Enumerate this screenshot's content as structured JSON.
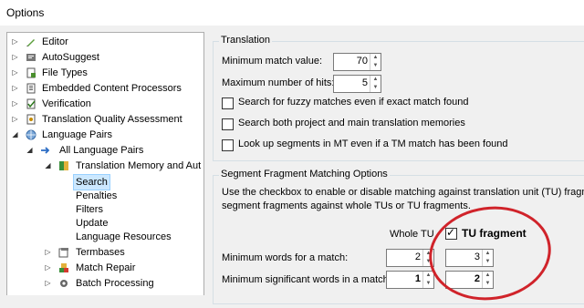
{
  "window": {
    "title": "Options"
  },
  "tree": [
    {
      "label": "Editor",
      "icon": "pencil-icon",
      "indent": 0
    },
    {
      "label": "AutoSuggest",
      "icon": "autosuggest-icon",
      "indent": 0
    },
    {
      "label": "File Types",
      "icon": "file-types-icon",
      "indent": 0
    },
    {
      "label": "Embedded Content Processors",
      "icon": "processor-icon",
      "indent": 0
    },
    {
      "label": "Verification",
      "icon": "verification-icon",
      "indent": 0
    },
    {
      "label": "Translation Quality Assessment",
      "icon": "quality-icon",
      "indent": 0
    },
    {
      "label": "Language Pairs",
      "icon": "globe-icon",
      "indent": 0
    },
    {
      "label": "All Language Pairs",
      "icon": "arrow-right-icon",
      "indent": 1
    },
    {
      "label": "Translation Memory and Aut",
      "icon": "tm-icon",
      "indent": 2
    },
    {
      "label": "Search",
      "icon": "",
      "indent": 3,
      "selected": true
    },
    {
      "label": "Penalties",
      "icon": "",
      "indent": 3
    },
    {
      "label": "Filters",
      "icon": "",
      "indent": 3
    },
    {
      "label": "Update",
      "icon": "",
      "indent": 3
    },
    {
      "label": "Language Resources",
      "icon": "",
      "indent": 3
    },
    {
      "label": "Termbases",
      "icon": "termbase-icon",
      "indent": 2
    },
    {
      "label": "Match Repair",
      "icon": "match-repair-icon",
      "indent": 2
    },
    {
      "label": "Batch Processing",
      "icon": "gear-icon",
      "indent": 2
    }
  ],
  "translation": {
    "title": "Translation",
    "min_match_label": "Minimum match value:",
    "min_match_value": "70",
    "max_hits_label": "Maximum number of hits:",
    "max_hits_value": "5",
    "fuzzy_label": "Search for fuzzy matches even if exact match found",
    "both_tm_label": "Search both project and main translation memories",
    "mt_label": "Look up segments in MT even if a TM match has been found"
  },
  "fragment": {
    "title": "Segment Fragment Matching Options",
    "desc1": "Use the checkbox to enable or disable matching against translation unit (TU) fragments.",
    "desc2": "segment fragments against whole TUs or TU fragments.",
    "whole_tu_header": "Whole TU",
    "tu_fragment_header": "TU fragment",
    "min_words_label": "Minimum words for a match:",
    "min_words_whole": "2",
    "min_words_fragment": "3",
    "min_sig_label": "Minimum significant words in a match:",
    "min_sig_whole": "1",
    "min_sig_fragment": "2"
  },
  "colors": {
    "highlight_circle": "#d0232a",
    "selection": "#cce8ff"
  }
}
